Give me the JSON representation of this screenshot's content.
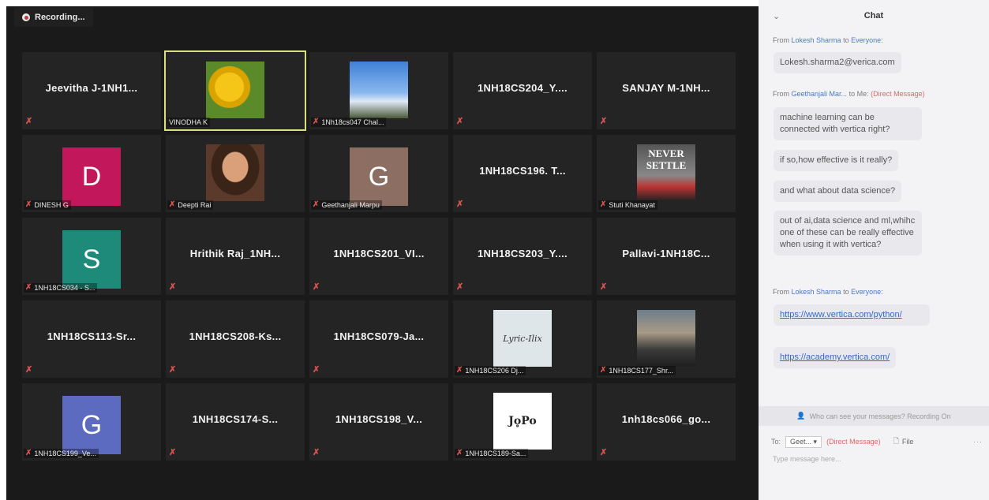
{
  "recording": {
    "label": "Recording..."
  },
  "tiles": [
    {
      "name": "Jeevitha J-1NH1...",
      "kind": "name"
    },
    {
      "name": "VINODHA K",
      "kind": "photo-flower",
      "active": true
    },
    {
      "name": "1Nh18cs047 Chal...",
      "kind": "photo-sky"
    },
    {
      "name": "1NH18CS204_Y....",
      "kind": "name"
    },
    {
      "name": "SANJAY M-1NH...",
      "kind": "name"
    },
    {
      "name": "DINESH G",
      "kind": "avatar",
      "letter": "D",
      "color": "#c2185b"
    },
    {
      "name": "Deepti Rai",
      "kind": "photo-person"
    },
    {
      "name": "Geethanjali Marpu",
      "kind": "avatar",
      "letter": "G",
      "color": "#8d6e63"
    },
    {
      "name": "1NH18CS196. T...",
      "kind": "name"
    },
    {
      "name": "Stuti Khanayat",
      "kind": "photo-never"
    },
    {
      "name": "1NH18CS034 - S...",
      "kind": "avatar",
      "letter": "S",
      "color": "#1e8a7a"
    },
    {
      "name": "Hrithik  Raj_1NH...",
      "kind": "name"
    },
    {
      "name": "1NH18CS201_VI...",
      "kind": "name"
    },
    {
      "name": "1NH18CS203_Y....",
      "kind": "name"
    },
    {
      "name": "Pallavi-1NH18C...",
      "kind": "name"
    },
    {
      "name": "1NH18CS113-Sr...",
      "kind": "name"
    },
    {
      "name": "1NH18CS208-Ks...",
      "kind": "name"
    },
    {
      "name": "1NH18CS079-Ja...",
      "kind": "name"
    },
    {
      "name": "1NH18CS206 Dj...",
      "kind": "photo-lyric",
      "photo_text": "Lyric-Ilix"
    },
    {
      "name": "1NH18CS177_Shr...",
      "kind": "photo-city"
    },
    {
      "name": "1NH18CS199_Ve...",
      "kind": "avatar",
      "letter": "G",
      "color": "#5c6bc0"
    },
    {
      "name": "1NH18CS174-S...",
      "kind": "name"
    },
    {
      "name": "1NH18CS198_V...",
      "kind": "name"
    },
    {
      "name": "1NH18CS189-Sa...",
      "kind": "photo-jopo",
      "photo_text": "Jo̥Po"
    },
    {
      "name": "1nh18cs066_go...",
      "kind": "name"
    }
  ],
  "never_settle": {
    "line1": "NEVER",
    "line2": "SETTLE"
  },
  "chat": {
    "title": "Chat",
    "collapse_icon": "chevron-down-icon",
    "from1": {
      "prefix": "From",
      "sender": "Lokesh Sharma",
      "to": "to",
      "target": "Everyone:"
    },
    "msg1": "Lokesh.sharma2@verica.com",
    "from2": {
      "prefix": "From",
      "sender": "Geethanjali Mar...",
      "to": "to Me:",
      "dm": "(Direct Message)"
    },
    "msg2": "machine learning can be connected with vertica right?",
    "msg3": "if so,how effective is it really?",
    "msg4": "and what about data science?",
    "msg5": "out of ai,data science and ml,whihc one of these can be really effective when using it with vertica?",
    "from3": {
      "prefix": "From",
      "sender": "Lokesh Sharma",
      "to": "to",
      "target": "Everyone:"
    },
    "link1": "https://www.vertica.com/python/",
    "link2": "https://academy.vertica.com/",
    "visibility": "Who can see your messages? Recording On",
    "to_label": "To:",
    "to_value": "Geet...",
    "to_dm": "(Direct Message)",
    "file_label": "File",
    "more_label": "···",
    "input_placeholder": "Type message here..."
  }
}
